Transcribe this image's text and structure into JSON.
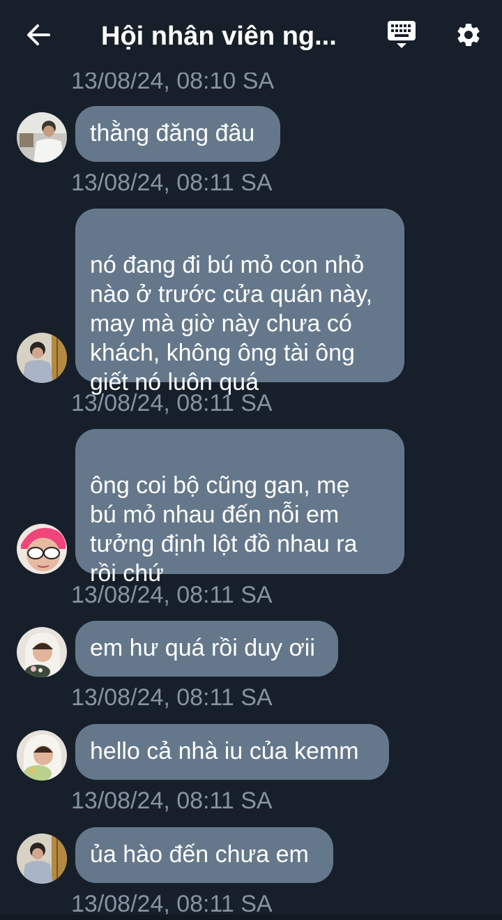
{
  "header": {
    "title": "Hội nhân viên ng...",
    "back_icon": "arrow-left-icon",
    "keyboard_icon": "keyboard-icon",
    "settings_icon": "gear-icon"
  },
  "colors": {
    "background": "#17202a",
    "bubble": "#65788b",
    "timestamp": "#8593a3",
    "text": "#ffffff"
  },
  "messages": [
    {
      "text": "",
      "timestamp": "13/08/24, 08:10 SA"
    },
    {
      "text": "thằng đăng đâu",
      "timestamp": "13/08/24, 08:11 SA"
    },
    {
      "text": "nó đang đi bú mỏ con nhỏ\nnào ở trước cửa quán này,\nmay mà giờ này chưa có\nkhách, không ông tài ông\ngiết nó luôn quá",
      "timestamp": "13/08/24, 08:11 SA"
    },
    {
      "text": "ông coi bộ cũng gan, mẹ\nbú mỏ nhau đến nỗi em\ntưởng định lột đồ nhau ra\nrồi chứ",
      "timestamp": "13/08/24, 08:11 SA"
    },
    {
      "text": "em hư quá rồi duy ơii",
      "timestamp": "13/08/24, 08:11 SA"
    },
    {
      "text": "hello cả nhà iu của kemm",
      "timestamp": "13/08/24, 08:11 SA"
    },
    {
      "text": "ủa hào đến chưa em",
      "timestamp": "13/08/24, 08:11 SA"
    }
  ]
}
